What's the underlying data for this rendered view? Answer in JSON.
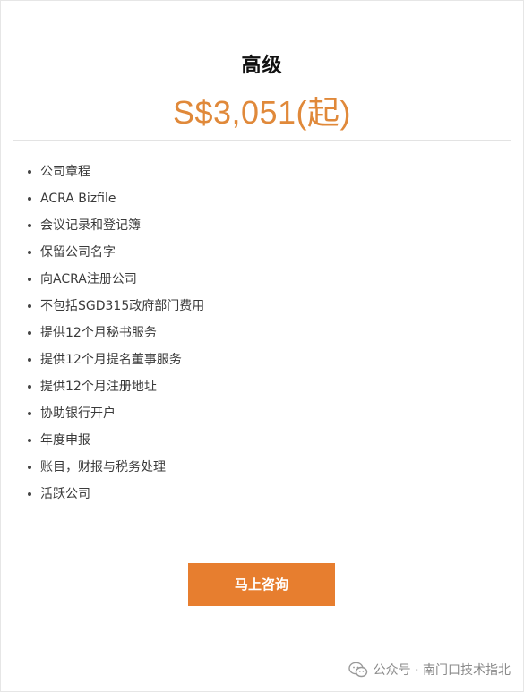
{
  "plan": {
    "title": "高级",
    "price": "S$3,051(起)"
  },
  "features": [
    "公司章程",
    "ACRA Bizfile",
    "会议记录和登记簿",
    "保留公司名字",
    "向ACRA注册公司",
    "不包括SGD315政府部门费用",
    "提供12个月秘书服务",
    "提供12个月提名董事服务",
    "提供12个月注册地址",
    "协助银行开户",
    "年度申报",
    "账目，财报与税务处理",
    "活跃公司"
  ],
  "cta": {
    "label": "马上咨询"
  },
  "watermark": {
    "text": "公众号 · 南门口技术指北",
    "icon": "wechat-icon"
  },
  "colors": {
    "accent": "#e0893a",
    "button": "#e77e2f"
  }
}
